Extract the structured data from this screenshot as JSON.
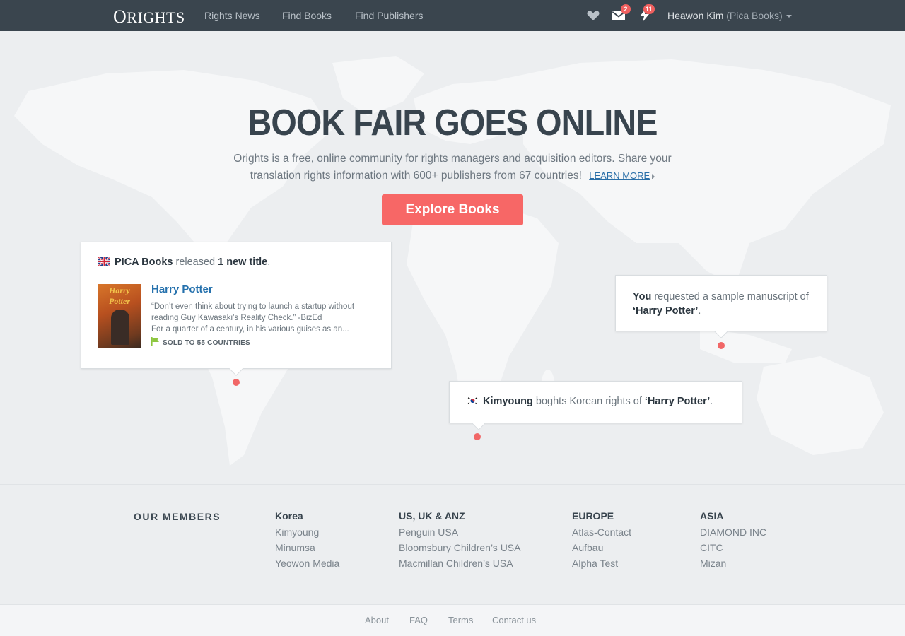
{
  "nav": {
    "logo": "Orights",
    "links": [
      "Rights News",
      "Find Books",
      "Find Publishers"
    ],
    "message_count": "2",
    "notification_count": "11",
    "user_name": "Heawon Kim",
    "user_org": "(Pica Books)"
  },
  "hero": {
    "title": "BOOK FAIR GOES ONLINE",
    "subtitle": "Orights is a free, online community for rights managers and acquisition editors. Share your translation rights information with 600+ publishers from 67 countries!",
    "learn_more": "LEARN MORE",
    "cta": "Explore Books"
  },
  "feed": {
    "release": {
      "publisher": "PICA Books",
      "verb": "released",
      "count": "1 new title",
      "book_title": "Harry Potter",
      "cover_text": "Harry Potter",
      "quote": "“Don’t even think about trying to launch a startup without reading Guy Kawasaki’s Reality Check.” -BizEd",
      "blurb": "For a quarter of a century, in his various guises as an...",
      "sold": "SOLD TO 55 COUNTRIES"
    },
    "request": {
      "who": "You",
      "action": "requested a sample manuscript of",
      "title": "‘Harry Potter’"
    },
    "purchase": {
      "who": "Kimyoung",
      "action": "boghts Korean rights of",
      "title": "‘Harry Potter’"
    }
  },
  "members": {
    "title": "OUR MEMBERS",
    "columns": [
      {
        "region": "Korea",
        "items": [
          "Kimyoung",
          "Minumsa",
          "Yeowon Media"
        ]
      },
      {
        "region": "US, UK & ANZ",
        "items": [
          "Penguin USA",
          "Bloomsbury Children’s USA",
          "Macmillan Children’s USA"
        ]
      },
      {
        "region": "EUROPE",
        "items": [
          "Atlas-Contact",
          "Aufbau",
          "Alpha Test"
        ]
      },
      {
        "region": "ASIA",
        "items": [
          "DIAMOND INC",
          "CITC",
          "Mizan"
        ]
      }
    ]
  },
  "footer": {
    "links": [
      "About",
      "FAQ",
      "Terms",
      "Contact us"
    ]
  },
  "icons": {
    "likes": "heart-icon",
    "messages": "envelope-icon",
    "notifications": "lightning-icon",
    "sold": "flag-icon"
  },
  "colors": {
    "nav_bg": "#3a454e",
    "accent": "#f76766",
    "link": "#2571ad",
    "sold_flag": "#8dc63f"
  }
}
